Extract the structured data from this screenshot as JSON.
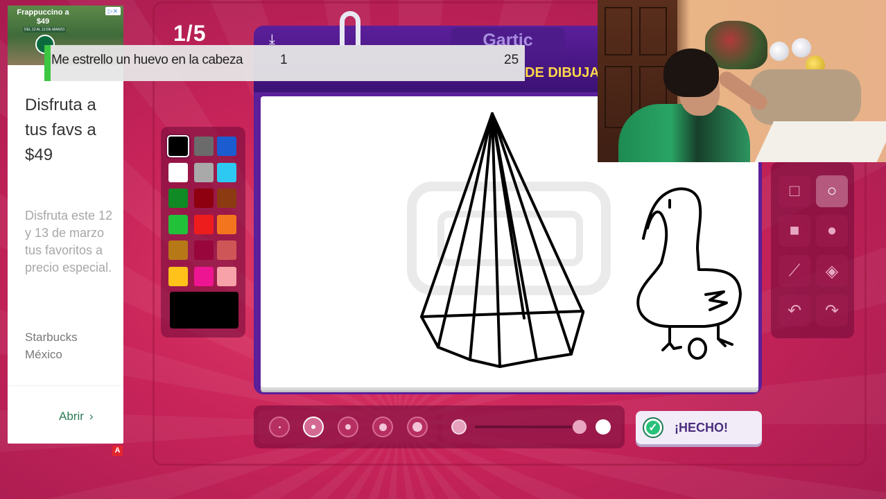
{
  "ad": {
    "banner_title": "Frappuccino a $49",
    "banner_sub": "DEL 12 AL 13 DE MARZO",
    "headline": "Disfruta a tus favs a $49",
    "body": "Disfruta este 12 y 13 de marzo tus favoritos a precio especial.",
    "brand": "Starbucks México",
    "cta": "Abrir",
    "cta_icon": "chevron-right-icon",
    "choices_icon": "adchoices-icon"
  },
  "game": {
    "round": "1/5",
    "logo": "Gartic",
    "mode": "DE DIBUJA",
    "done_label": "¡HECHO!"
  },
  "notification": {
    "message": "Me estrello un huevo en la cabeza",
    "value_a": "1",
    "value_b": "25"
  },
  "palette": {
    "colors": [
      "#000000",
      "#6b6b6b",
      "#1c5cd1",
      "#ffffff",
      "#a9a9a9",
      "#2ec9f2",
      "#0f8a25",
      "#8e0010",
      "#8b3a12",
      "#22c13a",
      "#ee1d1d",
      "#f3761e",
      "#b77818",
      "#98063c",
      "#cf5656",
      "#ffc21a",
      "#ee1592",
      "#f6a2a8"
    ],
    "selected": "#000000"
  },
  "tools": [
    "square-outline-icon",
    "circle-outline-icon",
    "square-filled-icon",
    "circle-filled-icon",
    "line-icon",
    "fill-bucket-icon",
    "undo-icon",
    "redo-icon"
  ],
  "brush_sizes": [
    1,
    2,
    3,
    4,
    5
  ],
  "selected_size": 2,
  "opacity": 1.0,
  "colors": {
    "accent": "#5b1f9a",
    "background": "#c8245a",
    "highlight": "#ffd54a"
  }
}
